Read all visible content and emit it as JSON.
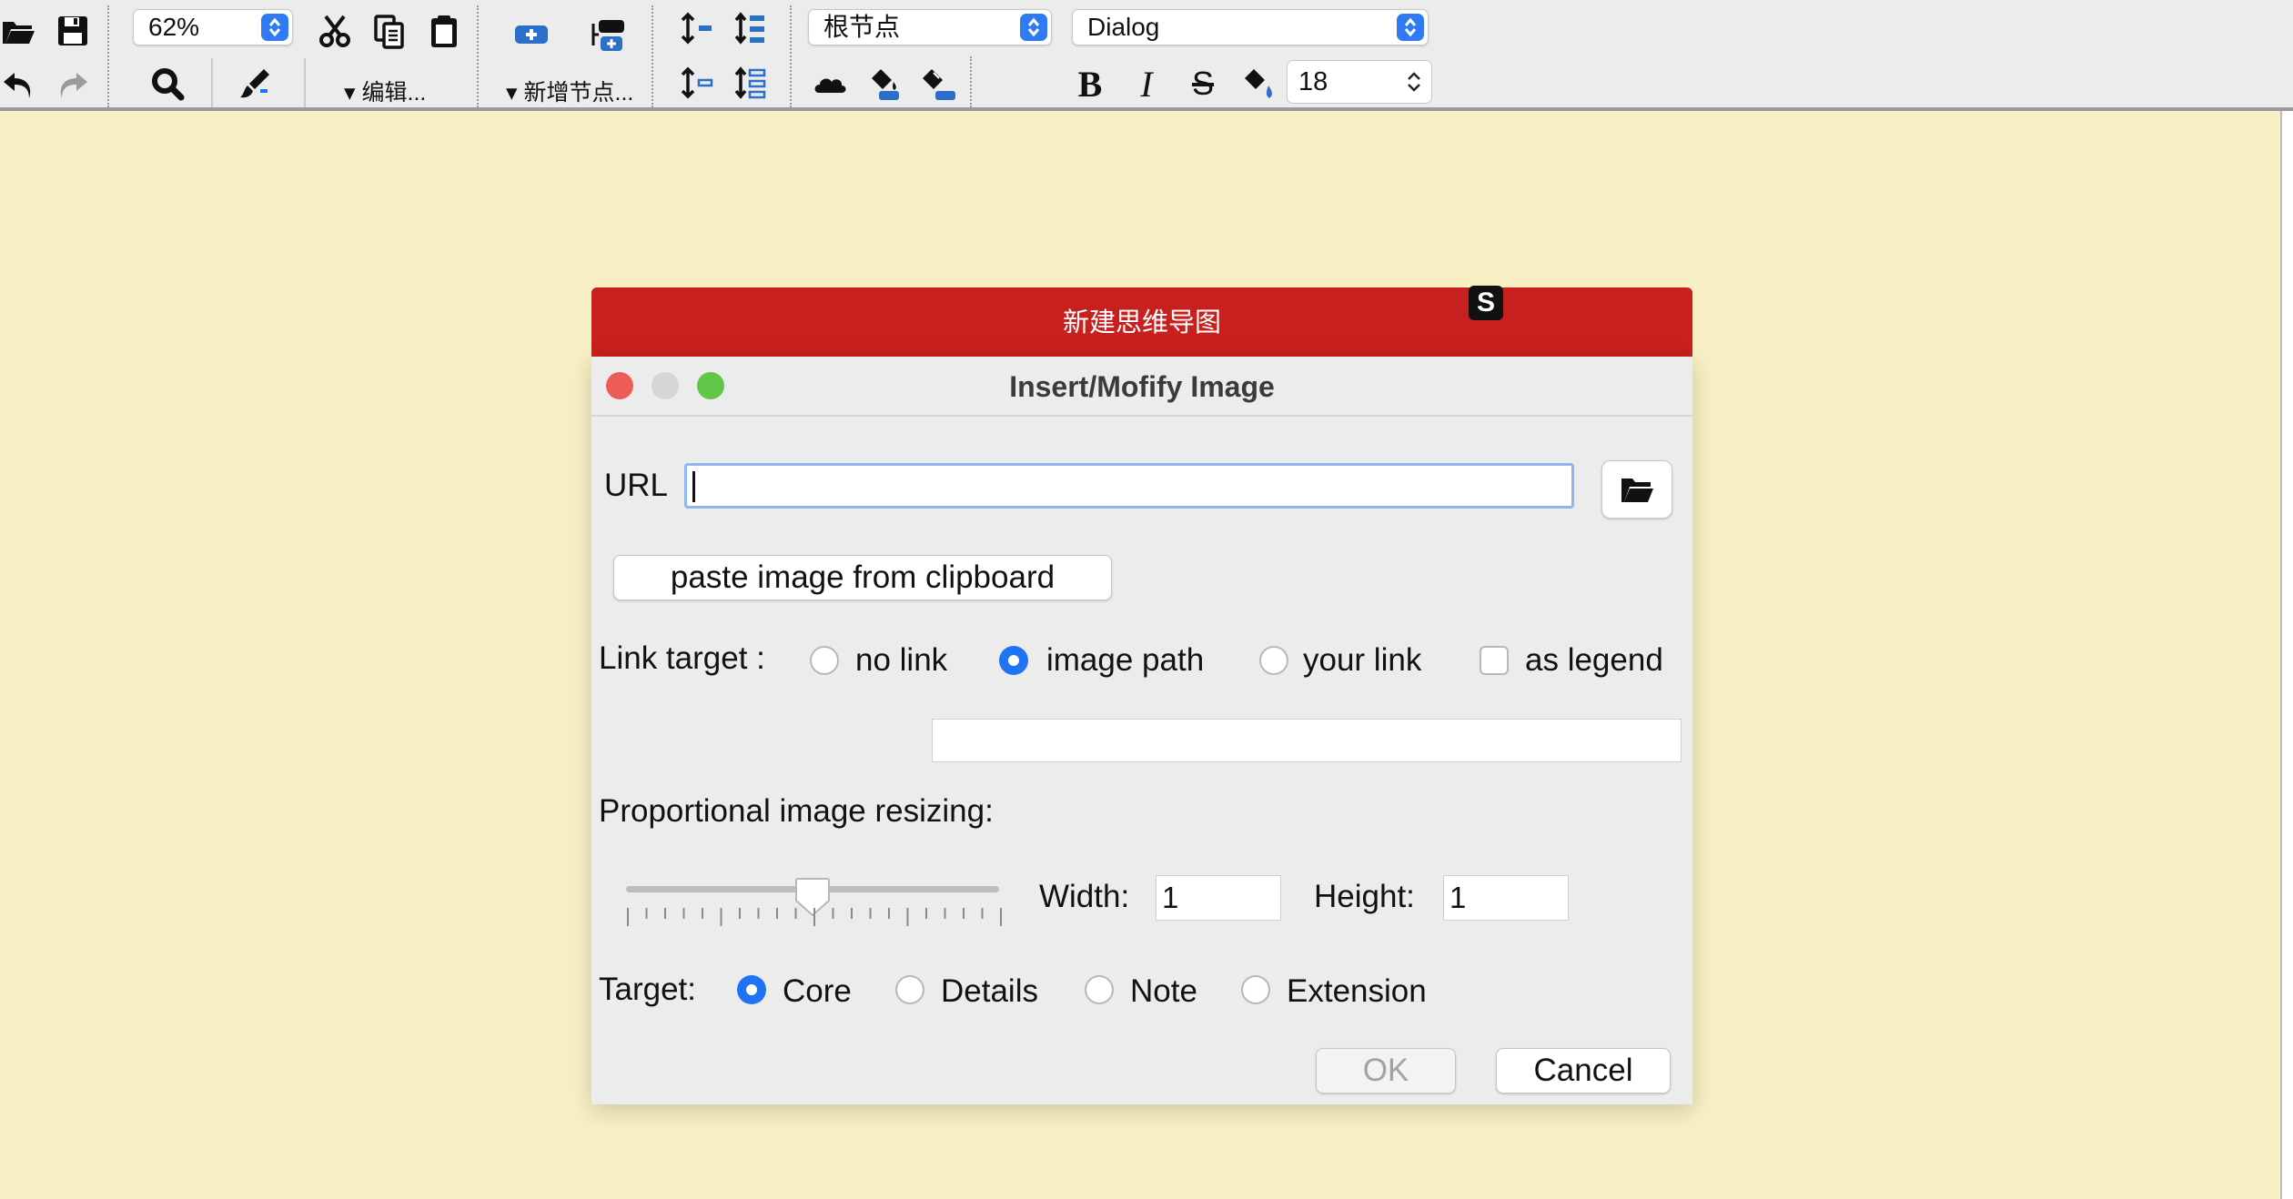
{
  "toolbar": {
    "zoom": "62%",
    "edit_menu": "编辑...",
    "new_node_menu": "新增节点...",
    "style_select": "根节点",
    "font_select": "Dialog",
    "font_size": "18",
    "bold_glyph": "B",
    "italic_glyph": "I",
    "strike_glyph": "S",
    "icons": [
      "open-folder-icon",
      "save-icon",
      "undo-icon",
      "redo-icon",
      "search-icon",
      "brush-icon",
      "cut-icon",
      "copy-icon",
      "paste-icon",
      "add-child-node-icon",
      "add-sibling-node-icon",
      "cloud-icon",
      "fill-color-icon",
      "edge-color-icon",
      "bold-icon",
      "italic-icon",
      "strikethrough-icon",
      "text-color-icon"
    ]
  },
  "app_banner": {
    "title": "新建思维导图",
    "badge": "S"
  },
  "dialog": {
    "title": "Insert/Mofify Image",
    "url_label": "URL",
    "url_value": "",
    "paste_button": "paste image from clipboard",
    "link_target_label": "Link target :",
    "link_options": [
      {
        "label": "no link",
        "selected": false
      },
      {
        "label": "image path",
        "selected": true
      },
      {
        "label": "your link",
        "selected": false
      }
    ],
    "as_legend_label": "as legend",
    "as_legend_checked": false,
    "link_value": "",
    "resize_label": "Proportional image resizing:",
    "slider_level": 0.5,
    "width_label": "Width:",
    "width_value": "1",
    "height_label": "Height:",
    "height_value": "1",
    "target_label": "Target:",
    "target_options": [
      {
        "label": "Core",
        "selected": true
      },
      {
        "label": "Details",
        "selected": false
      },
      {
        "label": "Note",
        "selected": false
      },
      {
        "label": "Extension",
        "selected": false
      }
    ],
    "ok_button": "OK",
    "cancel_button": "Cancel"
  },
  "colors": {
    "canvas": "#f9efc4",
    "banner": "#c8201e",
    "accent": "#1f74f6",
    "close": "#ee5d55",
    "zoom": "#5fc64a"
  }
}
